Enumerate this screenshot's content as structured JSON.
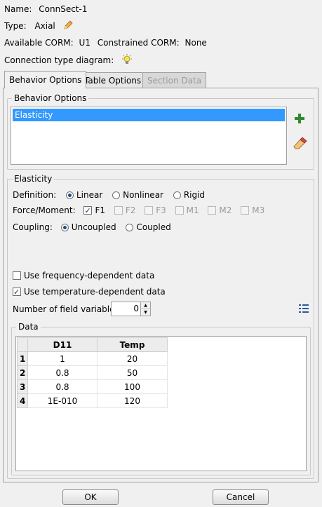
{
  "header": {
    "name_label": "Name:",
    "name_value": "ConnSect-1",
    "type_label": "Type:",
    "type_value": "Axial",
    "available_corm_label": "Available CORM:",
    "available_corm_value": "U1",
    "constrained_corm_label": "Constrained CORM:",
    "constrained_corm_value": "None",
    "diagram_label": "Connection type diagram:"
  },
  "tabs": [
    {
      "label": "Behavior Options",
      "state": "active"
    },
    {
      "label": "Table Options",
      "state": "normal"
    },
    {
      "label": "Section Data",
      "state": "disabled"
    }
  ],
  "behavior_options": {
    "group_label": "Behavior Options",
    "items": [
      "Elasticity"
    ],
    "selected": "Elasticity"
  },
  "elasticity": {
    "group_label": "Elasticity",
    "definition_label": "Definition:",
    "definition_options": [
      "Linear",
      "Nonlinear",
      "Rigid"
    ],
    "definition_selected": "Linear",
    "force_moment_label": "Force/Moment:",
    "components": [
      {
        "label": "F1",
        "checked": true,
        "enabled": true
      },
      {
        "label": "F2",
        "checked": false,
        "enabled": false
      },
      {
        "label": "F3",
        "checked": false,
        "enabled": false
      },
      {
        "label": "M1",
        "checked": false,
        "enabled": false
      },
      {
        "label": "M2",
        "checked": false,
        "enabled": false
      },
      {
        "label": "M3",
        "checked": false,
        "enabled": false
      }
    ],
    "coupling_label": "Coupling:",
    "coupling_options": [
      "Uncoupled",
      "Coupled"
    ],
    "coupling_selected": "Uncoupled",
    "freq_dep_label": "Use frequency-dependent data",
    "freq_dep_checked": false,
    "temp_dep_label": "Use temperature-dependent data",
    "temp_dep_checked": true,
    "field_vars_label": "Number of field variables:",
    "field_vars_value": "0"
  },
  "data_table": {
    "group_label": "Data",
    "columns": [
      "D11",
      "Temp"
    ],
    "rows": [
      {
        "index": "1",
        "d11": "1",
        "temp": "20"
      },
      {
        "index": "2",
        "d11": "0.8",
        "temp": "50"
      },
      {
        "index": "3",
        "d11": "0.8",
        "temp": "100"
      },
      {
        "index": "4",
        "d11": "1E-010",
        "temp": "120"
      }
    ]
  },
  "buttons": {
    "ok": "OK",
    "cancel": "Cancel"
  },
  "colors": {
    "selection": "#3399ff",
    "add_icon": "#2e8b2e"
  }
}
